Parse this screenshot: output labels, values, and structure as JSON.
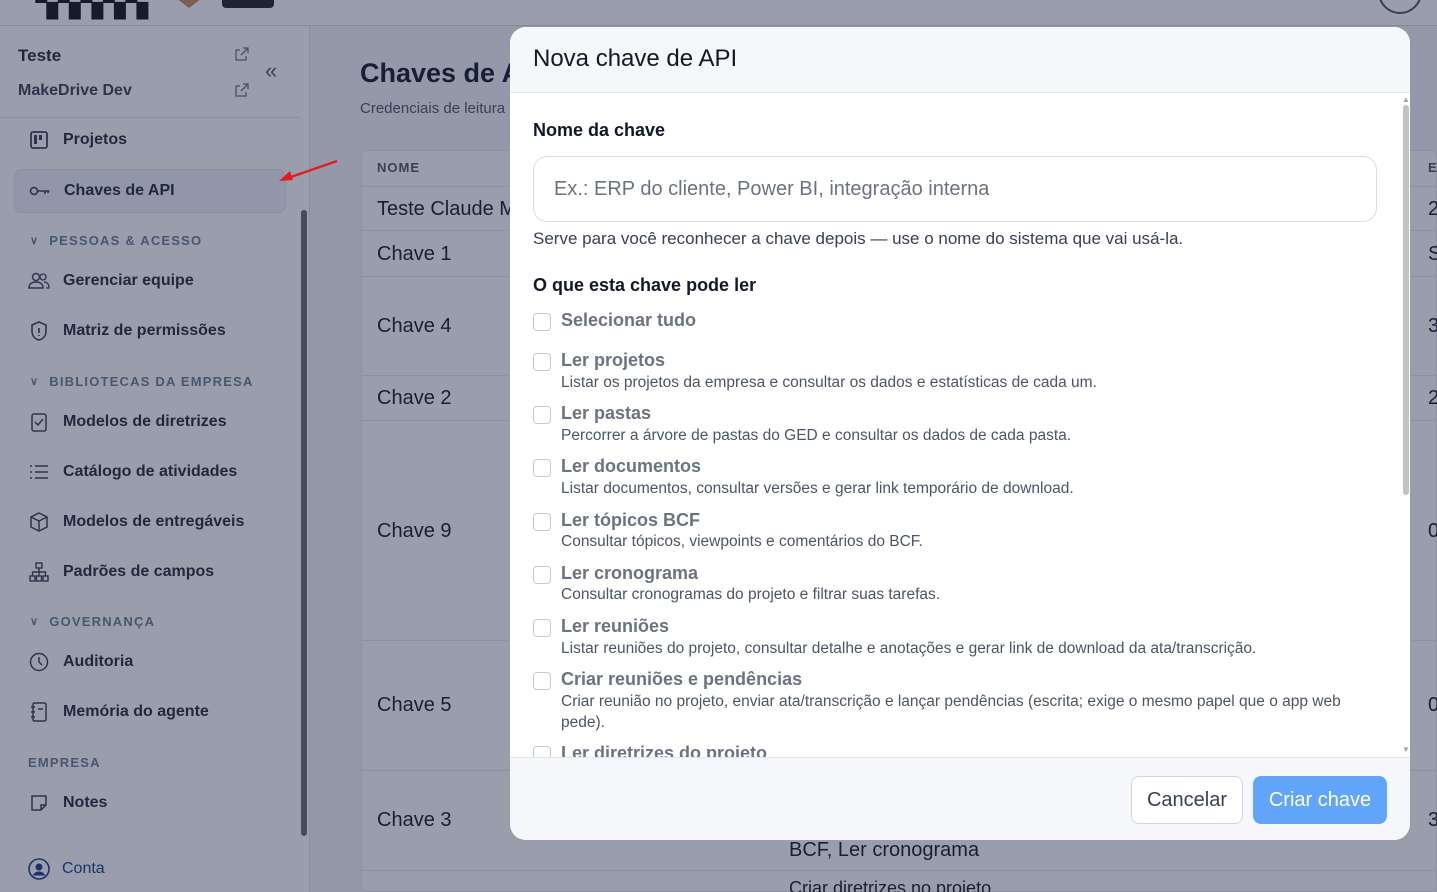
{
  "sidebar": {
    "workspace": "Teste",
    "project": "MakeDrive Dev",
    "nav": {
      "projetos": "Projetos",
      "chaves_api": "Chaves de API",
      "gerenciar_equipe": "Gerenciar equipe",
      "matriz_permissoes": "Matriz de permissões",
      "modelos_diretrizes": "Modelos de diretrizes",
      "catalogo_atividades": "Catálogo de atividades",
      "modelos_entregaveis": "Modelos de entregáveis",
      "padroes_campos": "Padrões de campos",
      "auditoria": "Auditoria",
      "memoria_agente": "Memória do agente",
      "notes": "Notes"
    },
    "sections": {
      "pessoas": "PESSOAS & ACESSO",
      "bibliotecas": "BIBLIOTECAS DA EMPRESA",
      "governanca": "GOVERNANÇA",
      "empresa": "EMPRESA"
    },
    "account": "Conta"
  },
  "main": {
    "title": "Chaves de A",
    "subtitle": "Credenciais de leitura",
    "table": {
      "header_name": "NOME",
      "header_right": "E",
      "rows": [
        {
          "name": "Teste Claude M",
          "right": "2"
        },
        {
          "name": "Chave 1",
          "right": "S"
        },
        {
          "name": "Chave 4",
          "right": "3"
        },
        {
          "name": "Chave 2",
          "right": "2"
        },
        {
          "name": "Chave 9",
          "right": "0"
        },
        {
          "name": "Chave 5",
          "right": "0"
        },
        {
          "name": "Chave 3",
          "right": "3"
        }
      ],
      "perm_text_1": "BCF, Ler cronograma",
      "perm_text_2": "Criar diretrizes no projeto"
    }
  },
  "modal": {
    "title": "Nova chave de API",
    "name_label": "Nome da chave",
    "name_placeholder": "Ex.: ERP do cliente, Power BI, integração interna",
    "name_help": "Serve para você reconhecer a chave depois — use o nome do sistema que vai usá-la.",
    "perms_label": "O que esta chave pode ler",
    "select_all": "Selecionar tudo",
    "options": [
      {
        "title": "Ler projetos",
        "desc": "Listar os projetos da empresa e consultar os dados e estatísticas de cada um."
      },
      {
        "title": "Ler pastas",
        "desc": "Percorrer a árvore de pastas do GED e consultar os dados de cada pasta."
      },
      {
        "title": "Ler documentos",
        "desc": "Listar documentos, consultar versões e gerar link temporário de download."
      },
      {
        "title": "Ler tópicos BCF",
        "desc": "Consultar tópicos, viewpoints e comentários do BCF."
      },
      {
        "title": "Ler cronograma",
        "desc": "Consultar cronogramas do projeto e filtrar suas tarefas."
      },
      {
        "title": "Ler reuniões",
        "desc": "Listar reuniões do projeto, consultar detalhe e anotações e gerar link de download da ata/transcrição."
      },
      {
        "title": "Criar reuniões e pendências",
        "desc": "Criar reunião no projeto, enviar ata/transcrição e lançar pendências (escrita; exige o mesmo papel que o app web pede)."
      },
      {
        "title": "Ler diretrizes do projeto",
        "desc": ""
      }
    ],
    "cancel": "Cancelar",
    "create": "Criar chave"
  },
  "colors": {
    "primary_button": "#60a5fa",
    "arrow": "#e11d1d",
    "overlay": "#1e2946"
  }
}
